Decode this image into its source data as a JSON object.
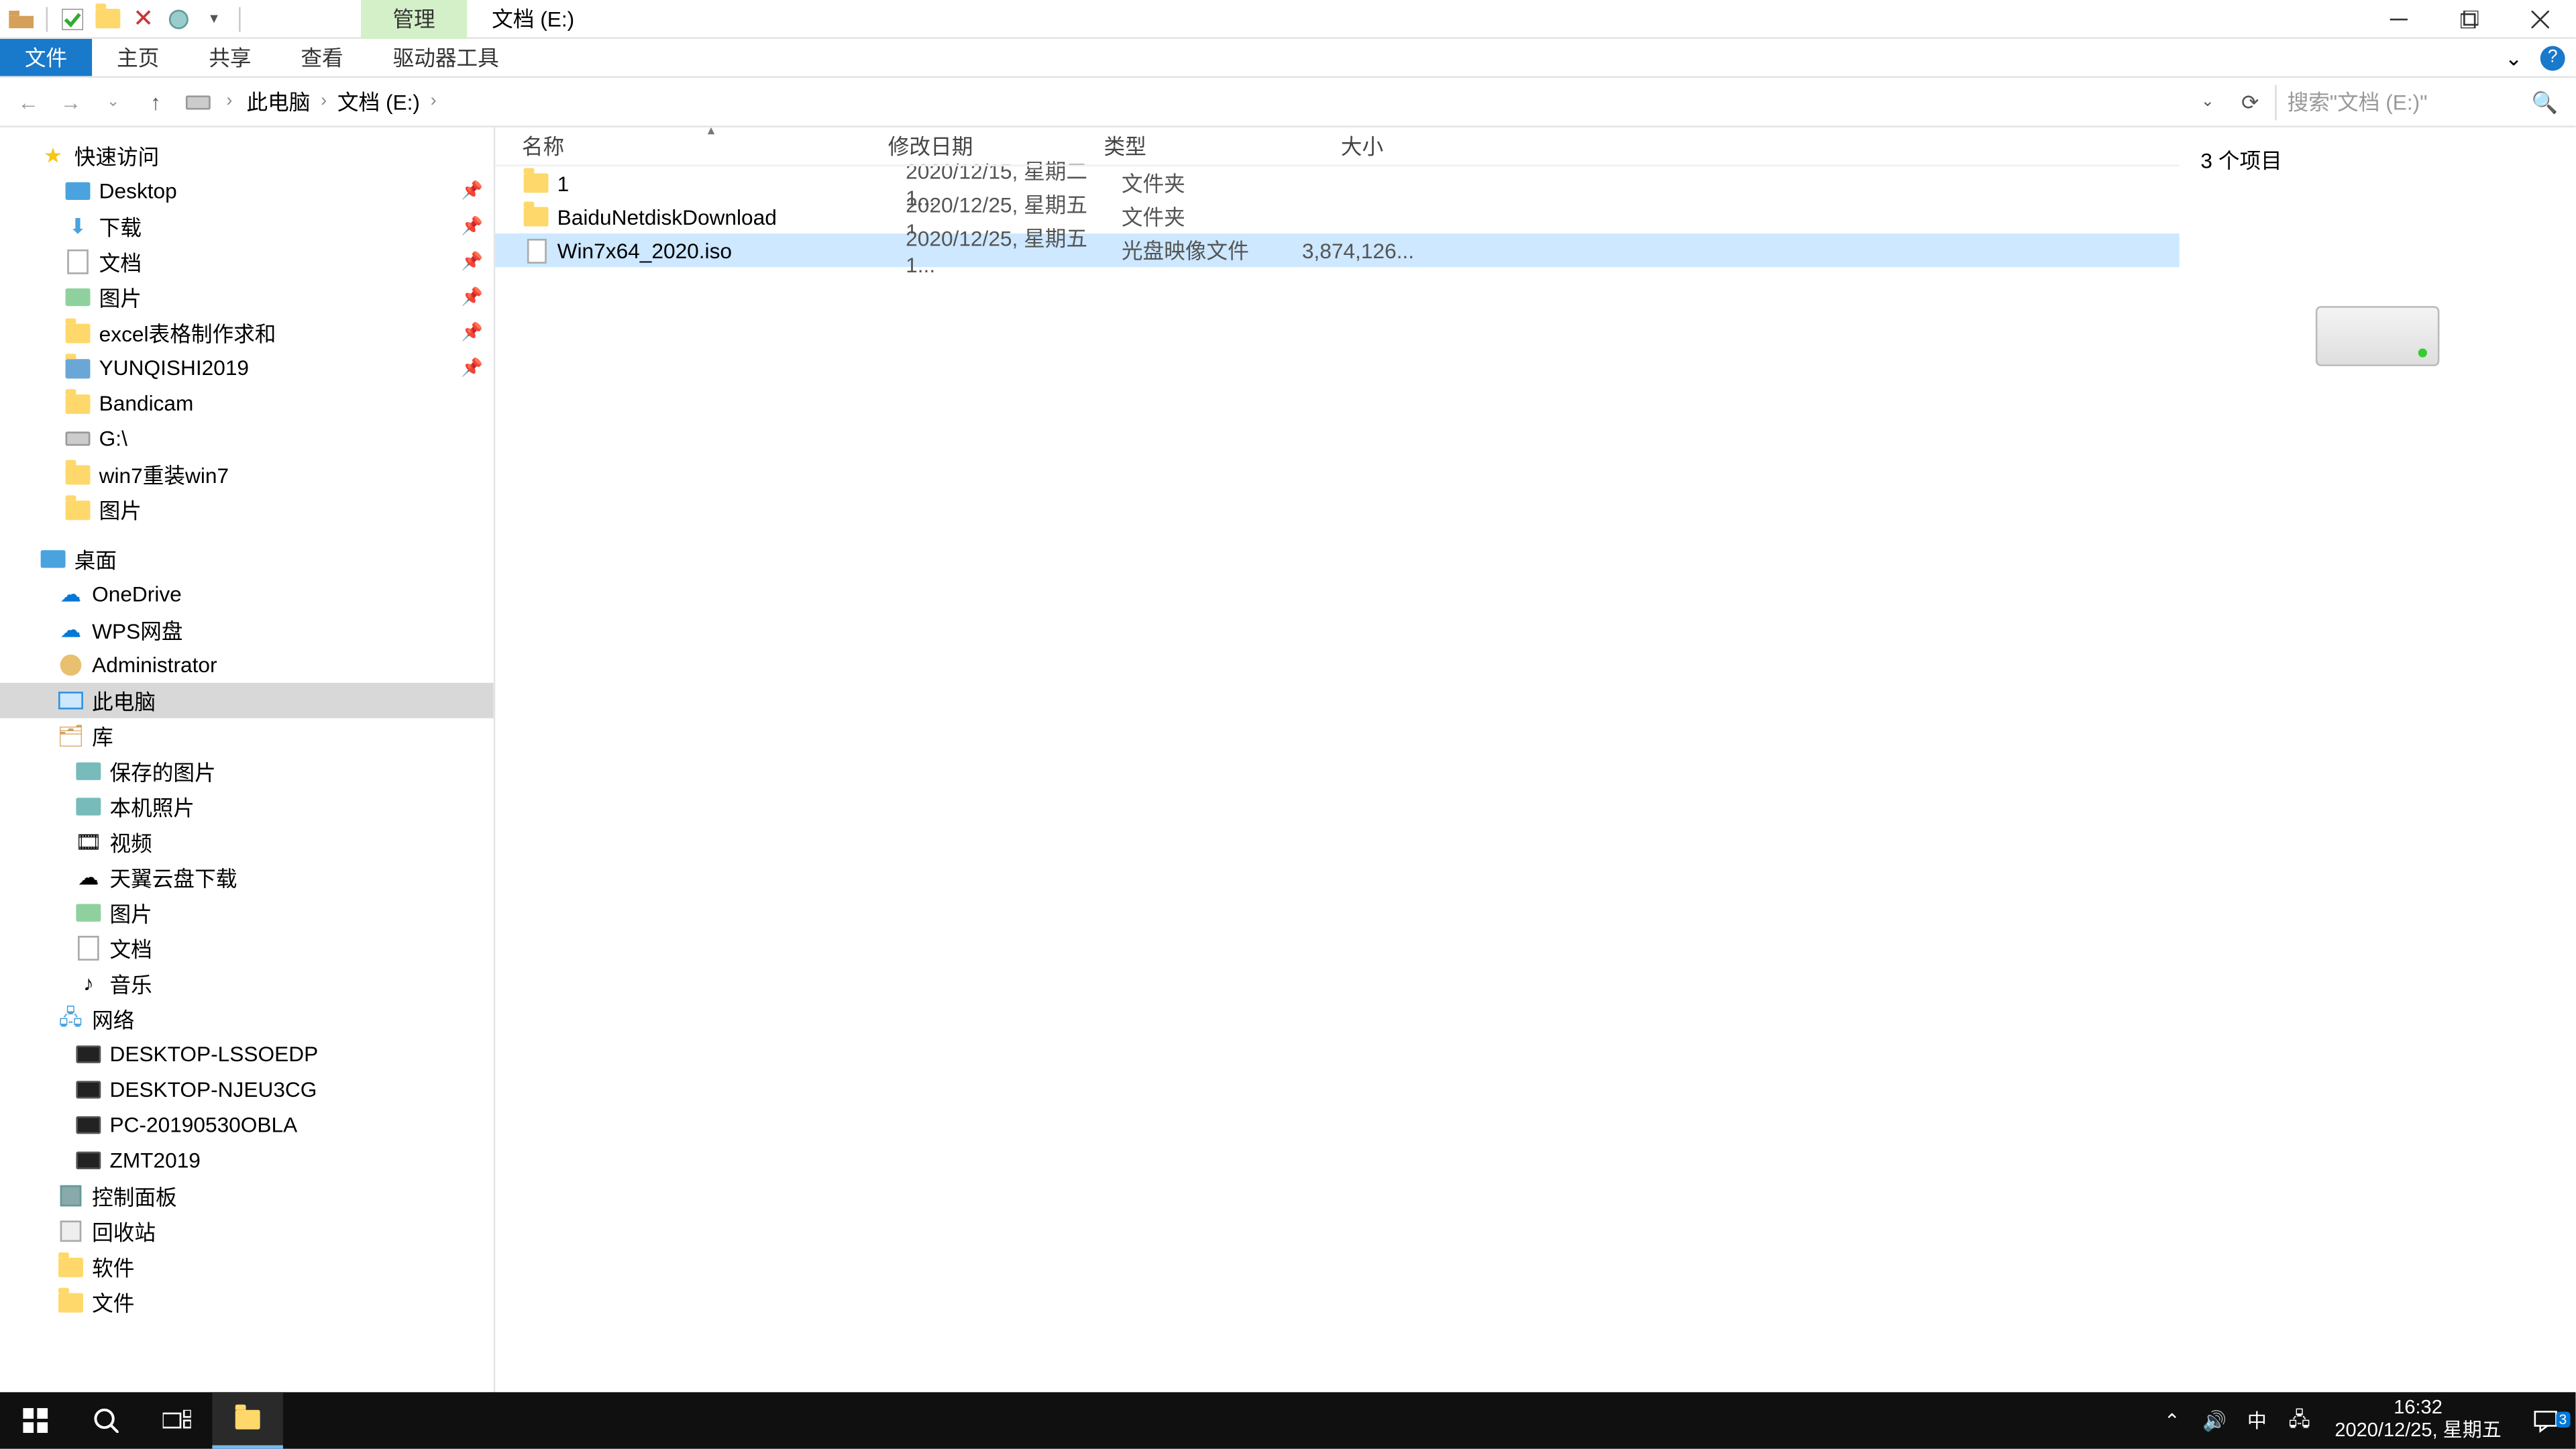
{
  "title_context_tab": "管理",
  "window_title": "文档 (E:)",
  "ribbon": {
    "file": "文件",
    "home": "主页",
    "share": "共享",
    "view": "查看",
    "drive_tools": "驱动器工具"
  },
  "breadcrumbs": {
    "b0": "此电脑",
    "b1": "文档 (E:)"
  },
  "search": {
    "placeholder": "搜索\"文档 (E:)\""
  },
  "columns": {
    "name": "名称",
    "date": "修改日期",
    "type": "类型",
    "size": "大小"
  },
  "rows": [
    {
      "name": "1",
      "date": "2020/12/15, 星期二 1...",
      "type": "文件夹",
      "size": ""
    },
    {
      "name": "BaiduNetdiskDownload",
      "date": "2020/12/25, 星期五 1...",
      "type": "文件夹",
      "size": ""
    },
    {
      "name": "Win7x64_2020.iso",
      "date": "2020/12/25, 星期五 1...",
      "type": "光盘映像文件",
      "size": "3,874,126..."
    }
  ],
  "preview": {
    "title": "3 个项目"
  },
  "status": {
    "left": "3 个项目"
  },
  "tree": {
    "quick_access": "快速访问",
    "desktop": "Desktop",
    "downloads": "下载",
    "documents": "文档",
    "pictures": "图片",
    "excel": "excel表格制作求和",
    "yunqishi": "YUNQISHI2019",
    "bandicam": "Bandicam",
    "g_drive": "G:\\",
    "win7reinstall": "win7重装win7",
    "pictures2": "图片",
    "desktop_section": "桌面",
    "onedrive": "OneDrive",
    "wps": "WPS网盘",
    "admin": "Administrator",
    "this_pc": "此电脑",
    "libraries": "库",
    "saved_pic": "保存的图片",
    "local_photo": "本机照片",
    "video": "视频",
    "tianyi": "天翼云盘下载",
    "pictures3": "图片",
    "documents2": "文档",
    "music": "音乐",
    "network": "网络",
    "pc1": "DESKTOP-LSSOEDP",
    "pc2": "DESKTOP-NJEU3CG",
    "pc3": "PC-20190530OBLA",
    "pc4": "ZMT2019",
    "control_panel": "控制面板",
    "recycle": "回收站",
    "software": "软件",
    "files": "文件"
  },
  "taskbar": {
    "ime": "中",
    "time": "16:32",
    "date": "2020/12/25, 星期五",
    "notify_count": "3"
  }
}
